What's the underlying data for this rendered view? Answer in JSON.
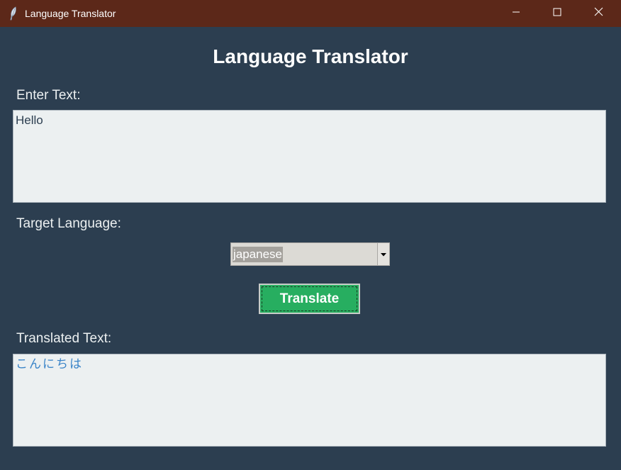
{
  "window": {
    "title": "Language Translator",
    "icons": {
      "app": "feather-icon",
      "minimize": "minimize-icon",
      "maximize": "maximize-icon",
      "close": "close-icon"
    }
  },
  "main": {
    "heading": "Language Translator",
    "input": {
      "label": "Enter Text:",
      "value": "Hello"
    },
    "target": {
      "label": "Target Language:",
      "selected": "japanese",
      "arrow_icon": "dropdown-arrow-icon"
    },
    "translate_button": "Translate",
    "output": {
      "label": "Translated Text:",
      "value": "こんにちは"
    }
  },
  "colors": {
    "titlebar": "#5c2819",
    "background": "#2c3e50",
    "textbox": "#ecf0f1",
    "button": "#27ae60",
    "output_text": "#3a84c8"
  }
}
